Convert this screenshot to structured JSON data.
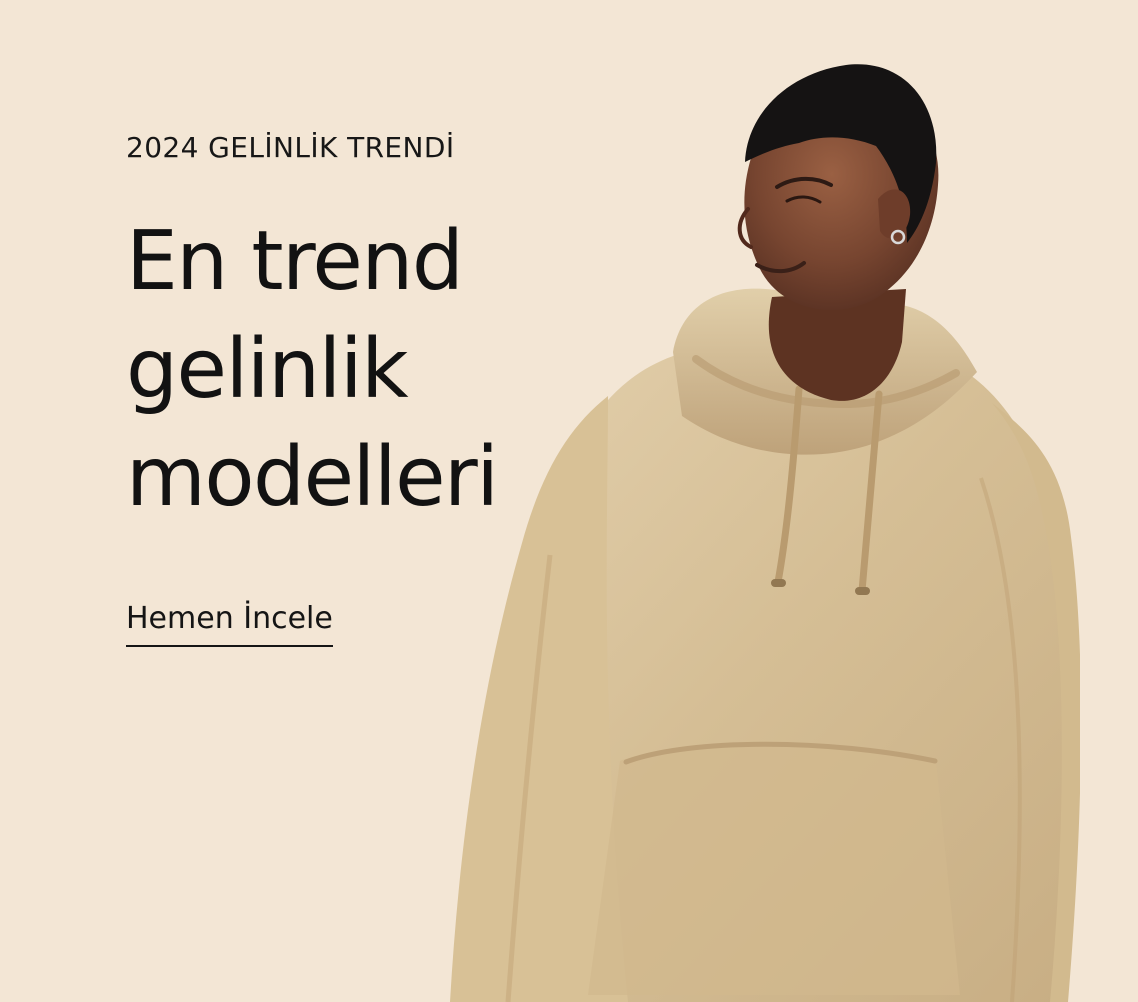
{
  "hero": {
    "eyebrow": "2024 GELİNLİK TRENDİ",
    "headline_lines": [
      "En trend",
      "gelinlik",
      "modelleri"
    ],
    "cta_label": "Hemen İncele"
  },
  "colors": {
    "background": "#f3e6d5",
    "text": "#141414",
    "hoodie": "#d8c39d",
    "skin": "#7d4b34",
    "hair": "#141312"
  },
  "image": {
    "subject": "model-wearing-beige-hoodie"
  }
}
